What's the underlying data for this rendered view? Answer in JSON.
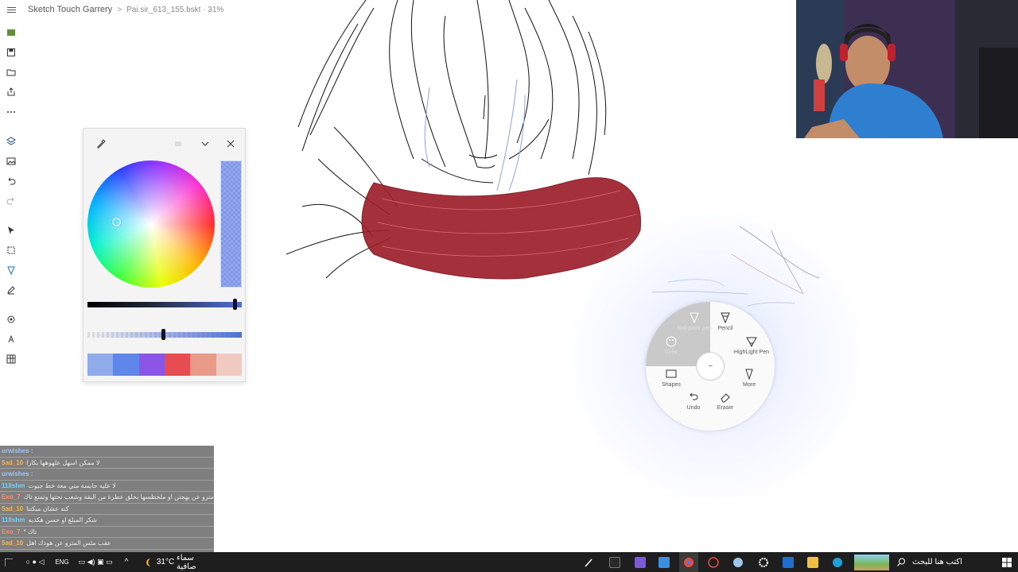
{
  "app": {
    "title": "Sketch Touch Garrery",
    "file": "Pai.sir_613_155.bskt · 31%"
  },
  "left_toolbar": {
    "icons": [
      "sticky-note-icon",
      "save-icon",
      "open-folder-icon",
      "export-icon",
      "more-icon",
      "layers-icon",
      "gallery-icon",
      "undo-icon",
      "redo-icon",
      "select-icon",
      "lasso-icon",
      "pen-icon",
      "edit-icon",
      "stamp-icon",
      "text-icon",
      "grid-icon"
    ]
  },
  "color_picker": {
    "swatch_colors": [
      "#8fabea",
      "#5f86e9",
      "#8d54e8",
      "#e84c53",
      "#e99a88",
      "#f0c9c0"
    ],
    "current_color": "#7f98e8"
  },
  "radial_menu": {
    "items": {
      "ballpoint": "Ball-point pen",
      "pencil": "Pencil",
      "highlight": "HighLight Pen",
      "color": "Color",
      "more": "More",
      "shapes": "Shapes",
      "undo": "Undo",
      "eraser": "Eraser"
    }
  },
  "chat": {
    "rows": [
      {
        "user": "urwishes :",
        "msg": "",
        "color": "#9ec2ff"
      },
      {
        "user": "5ad_10",
        "msg": "لا ممكن اسهل علهوهها بكارا",
        "color": "#ffb04d"
      },
      {
        "user": "urwishes :",
        "msg": "",
        "color": "#9ec2ff"
      },
      {
        "user": "11Ilshm",
        "msg": "لا عليه جايسة مني معة خط جيوت",
        "color": "#6fd4ff"
      },
      {
        "user": "Exo_7",
        "msg": "ياك مترو عن بهجتن او ملحظسها بحلق عطرة من البقة وشعب تحتها وتمتع تاك",
        "color": "#ff8f6b"
      },
      {
        "user": "5ad_10",
        "msg": "كنه عشان مبكتنا",
        "color": "#ffb04d"
      },
      {
        "user": "11Ilshm",
        "msg": "شكر المبلغ او حسن هكذيه",
        "color": "#6fd4ff"
      },
      {
        "user": "Exo_7",
        "msg": "تاك *",
        "color": "#ff8f6b"
      },
      {
        "user": "5ad_10",
        "msg": "عقب مئس المترو عن هودك اهل",
        "color": "#ffb04d"
      }
    ]
  },
  "taskbar": {
    "search_placeholder": "اكتب هنا للبحث",
    "weather_temp": "31°C",
    "weather_text": "سماء صافية",
    "lang": "ENG"
  }
}
